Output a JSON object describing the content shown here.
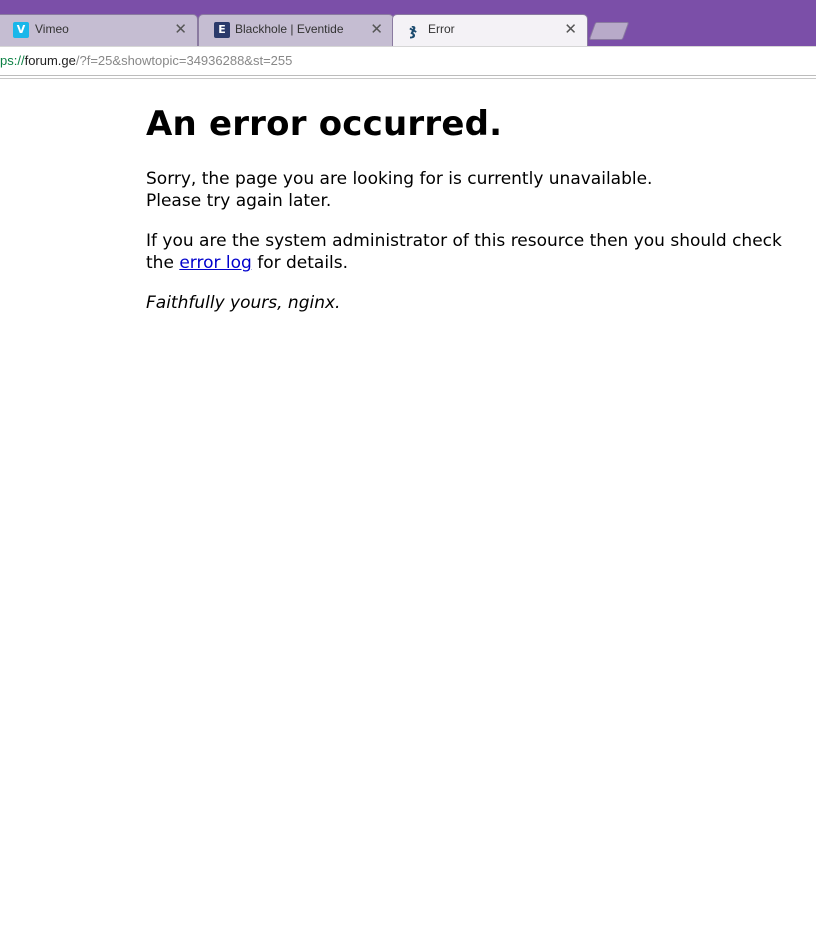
{
  "browser": {
    "tabs": [
      {
        "icon": "vimeo-icon",
        "favicon_text": "V",
        "favicon_color": "#1ab7ea",
        "label": "Vimeo",
        "active": false
      },
      {
        "icon": "eventide-icon",
        "favicon_text": "E",
        "favicon_color": "#2b3a6b",
        "label": "Blackhole | Eventide",
        "active": false
      },
      {
        "icon": "forum-icon",
        "favicon_text": "ჯ",
        "favicon_color": "#1a4a6e",
        "label": "Error",
        "active": true
      }
    ],
    "close_glyph": "✕",
    "address": {
      "scheme": "ps://",
      "host": "forum.ge",
      "path": "/?f=25&showtopic=34936288&st=255"
    },
    "accent_color": "#7b4fa8"
  },
  "page": {
    "title": "An error occurred.",
    "line1": "Sorry, the page you are looking for is currently unavailable.",
    "line2": "Please try again later.",
    "admin_text_before": "If you are the system administrator of this resource then you should check the",
    "error_log_link": "error log",
    "admin_text_after": "for details.",
    "signature": "Faithfully yours, nginx."
  }
}
